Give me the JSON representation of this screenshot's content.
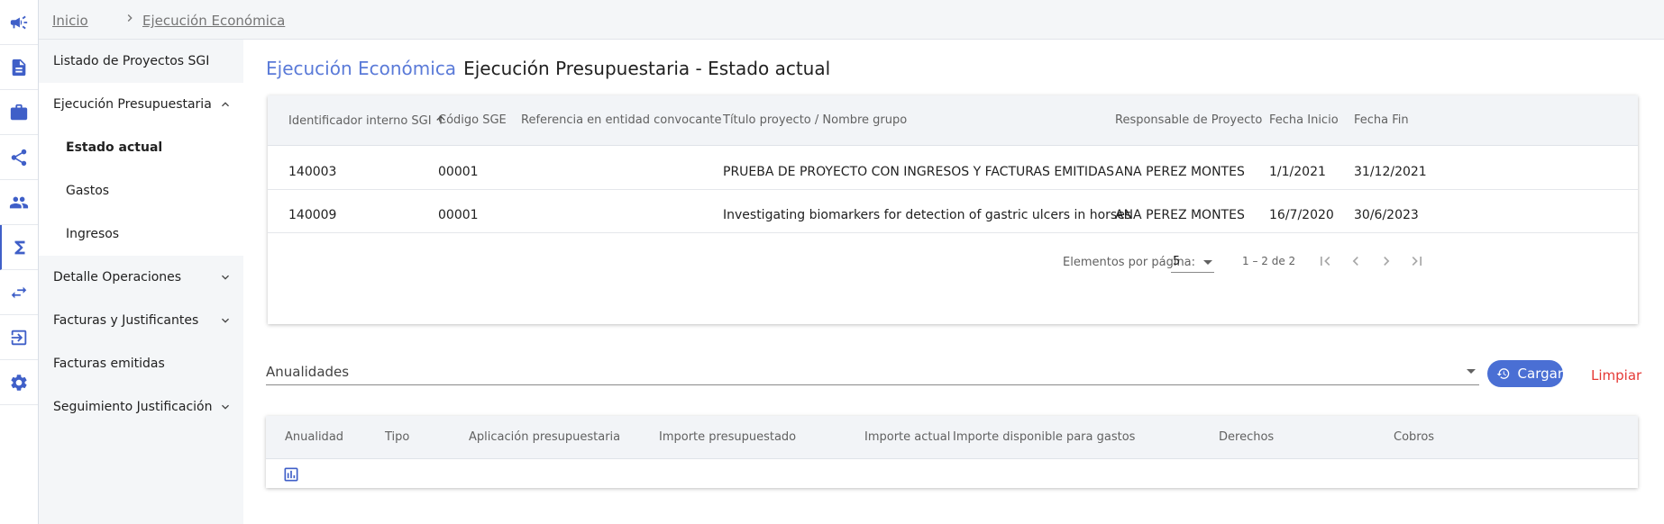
{
  "rail": {
    "items": [
      {
        "icon": "megaphone-icon"
      },
      {
        "icon": "document-icon"
      },
      {
        "icon": "briefcase-icon"
      },
      {
        "icon": "share-icon"
      },
      {
        "icon": "people-icon"
      },
      {
        "icon": "sigma-icon",
        "active": true
      },
      {
        "icon": "swap-arrows-icon"
      },
      {
        "icon": "logout-icon"
      },
      {
        "icon": "settings-icon"
      }
    ]
  },
  "breadcrumb": {
    "home": "Inicio",
    "current": "Ejecución Económica"
  },
  "sidebar": {
    "items": [
      {
        "label": "Listado de Proyectos SGI"
      },
      {
        "label": "Ejecución Presupuestaria",
        "expanded": true
      },
      {
        "label": "Estado actual",
        "selected": true
      },
      {
        "label": "Gastos"
      },
      {
        "label": "Ingresos"
      },
      {
        "label": "Detalle Operaciones"
      },
      {
        "label": "Facturas y Justificantes"
      },
      {
        "label": "Facturas emitidas"
      },
      {
        "label": "Seguimiento Justificación"
      }
    ]
  },
  "page": {
    "module": "Ejecución Económica",
    "section": "Ejecución Presupuestaria - Estado actual"
  },
  "projects_table": {
    "headers": [
      "Identificador interno SGI",
      "Código SGE",
      "Referencia en entidad convocante",
      "Título proyecto / Nombre grupo",
      "Responsable de Proyecto",
      "Fecha Inicio",
      "Fecha Fin"
    ],
    "rows": [
      [
        "140003",
        "00001",
        "",
        "PRUEBA DE PROYECTO CON INGRESOS Y FACTURAS EMITIDAS",
        "ANA PEREZ MONTES",
        "1/1/2021",
        "31/12/2021"
      ],
      [
        "140009",
        "00001",
        "",
        "Investigating biomarkers for detection of gastric ulcers in horses",
        "ANA PEREZ MONTES",
        "16/7/2020",
        "30/6/2023"
      ]
    ],
    "paginator": {
      "items_per_page_label": "Elementos por página:",
      "page_size": "5",
      "range": "1 – 2 de 2"
    }
  },
  "filter": {
    "anualidades_label": "Anualidades",
    "load_button": "Cargar",
    "clear_button": "Limpiar"
  },
  "budget_table": {
    "headers": [
      "Anualidad",
      "Tipo",
      "Aplicación presupuestaria",
      "Importe presupuestado",
      "Importe actual",
      "Importe disponible para gastos",
      "Derechos",
      "Cobros"
    ]
  },
  "colors": {
    "accent": "#4a6fd4",
    "module_title": "#5a7ad8",
    "clear": "#e53935"
  }
}
